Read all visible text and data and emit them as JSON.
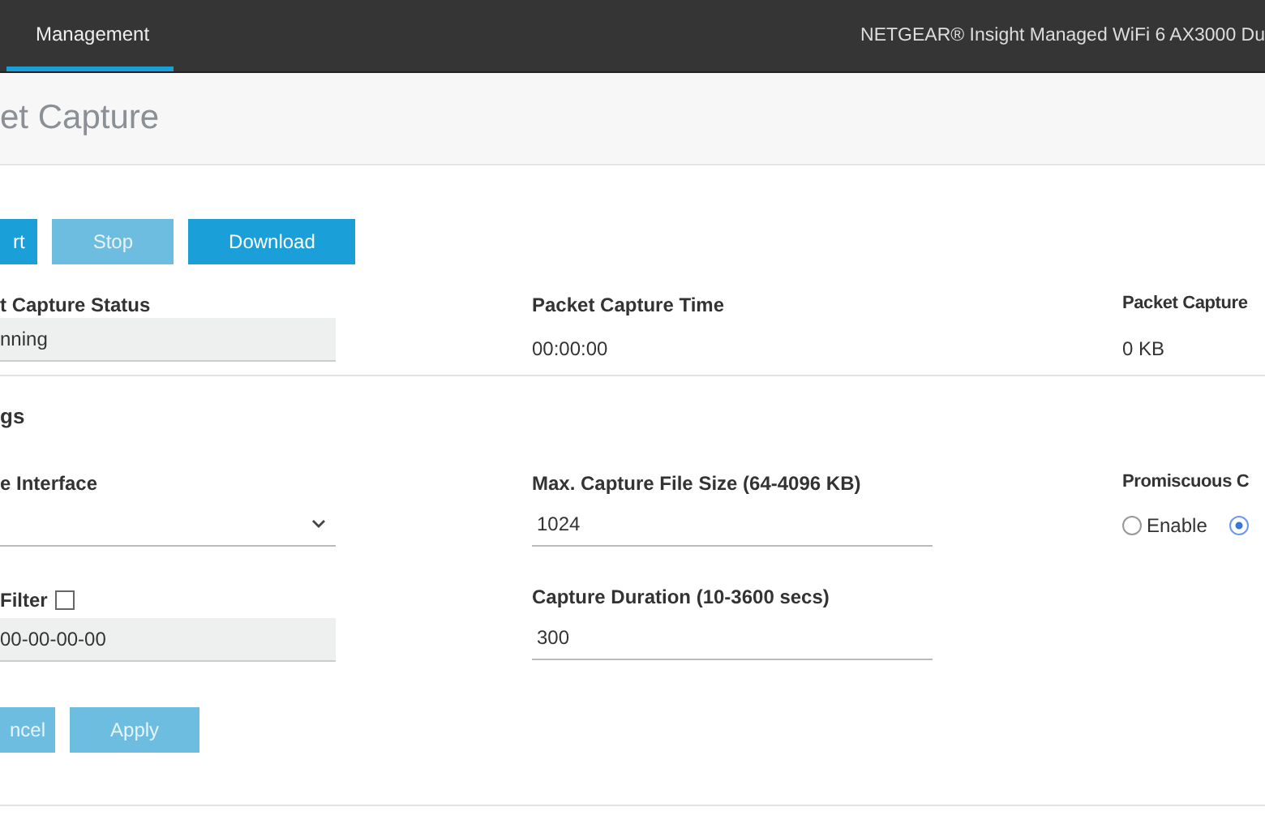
{
  "header": {
    "tab": {
      "label": "Management",
      "selected": true
    },
    "product": "NETGEAR® Insight Managed WiFi 6 AX3000 Du"
  },
  "page_title": "et Capture",
  "action_buttons": [
    {
      "label": "rt",
      "disabled": false
    },
    {
      "label": "Stop",
      "disabled": true
    },
    {
      "label": "Download",
      "disabled": false
    }
  ],
  "status": [
    {
      "label": "t Capture Status",
      "value": "nning",
      "kind": "field"
    },
    {
      "label": "Packet Capture Time",
      "value": "00:00:00",
      "kind": "text"
    },
    {
      "label": "Packet Capture",
      "value": "0 KB",
      "kind": "text"
    }
  ],
  "settings": {
    "title": "gs",
    "fields": [
      {
        "kind": "select",
        "label": "e Interface"
      },
      {
        "kind": "input",
        "label": "Max. Capture File Size (64-4096 KB)",
        "value": "1024"
      },
      {
        "kind": "radio",
        "label": "Promiscuous C",
        "options": [
          {
            "label": "Enable",
            "selected": false
          },
          {
            "selected": true
          }
        ]
      },
      {
        "kind": "filter",
        "label": "Filter",
        "checked": false,
        "value": "00-00-00-00"
      },
      {
        "kind": "input",
        "label": "Capture Duration (10-3600 secs)",
        "value": "300"
      },
      {
        "kind": "empty"
      }
    ],
    "buttons": [
      {
        "label": "ncel",
        "disabled": true
      },
      {
        "label": "Apply",
        "disabled": true
      }
    ]
  }
}
